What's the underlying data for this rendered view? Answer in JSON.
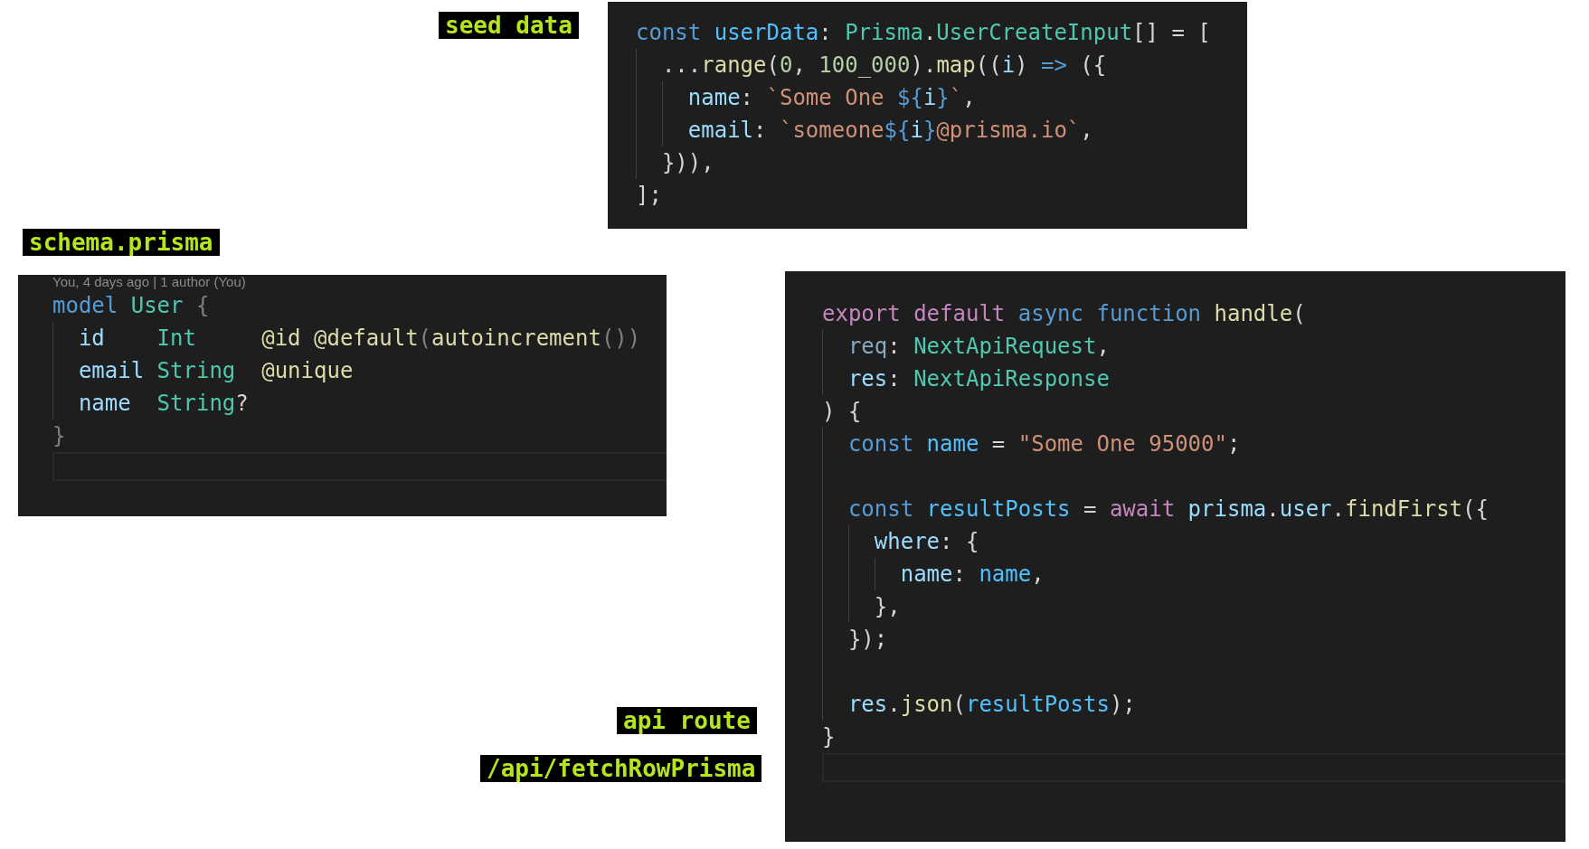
{
  "labels": [
    {
      "text": "seed data"
    },
    {
      "text": "schema.prisma"
    },
    {
      "text": "api route"
    },
    {
      "text": "/api/fetchRowPrisma"
    }
  ],
  "panels": [
    {
      "current_line_box": false,
      "lines": [
        {
          "kind": "code",
          "tokens": [
            {
              "kind": "kw",
              "text": "const "
            },
            {
              "kind": "vblue",
              "text": "userData"
            },
            {
              "kind": "p",
              "text": ": "
            },
            {
              "kind": "type",
              "text": "Prisma"
            },
            {
              "kind": "p",
              "text": "."
            },
            {
              "kind": "type",
              "text": "UserCreateInput"
            },
            {
              "kind": "p",
              "text": "[] = ["
            }
          ]
        },
        {
          "kind": "code",
          "tokens": [
            {
              "kind": "p",
              "text": "  ..."
            },
            {
              "kind": "fn",
              "text": "range"
            },
            {
              "kind": "p",
              "text": "("
            },
            {
              "kind": "num",
              "text": "0"
            },
            {
              "kind": "p",
              "text": ", "
            },
            {
              "kind": "num",
              "text": "100_000"
            },
            {
              "kind": "p",
              "text": ")."
            },
            {
              "kind": "fn",
              "text": "map"
            },
            {
              "kind": "p",
              "text": "(("
            },
            {
              "kind": "var",
              "text": "i"
            },
            {
              "kind": "p",
              "text": ") "
            },
            {
              "kind": "kw",
              "text": "=>"
            },
            {
              "kind": "p",
              "text": " ({"
            }
          ]
        },
        {
          "kind": "code",
          "tokens": [
            {
              "kind": "var",
              "text": "    name"
            },
            {
              "kind": "p",
              "text": ": "
            },
            {
              "kind": "str",
              "text": "`Some One "
            },
            {
              "kind": "kw",
              "text": "${"
            },
            {
              "kind": "var",
              "text": "i"
            },
            {
              "kind": "kw",
              "text": "}"
            },
            {
              "kind": "str",
              "text": "`"
            },
            {
              "kind": "p",
              "text": ","
            }
          ]
        },
        {
          "kind": "code",
          "tokens": [
            {
              "kind": "var",
              "text": "    email"
            },
            {
              "kind": "p",
              "text": ": "
            },
            {
              "kind": "str",
              "text": "`someone"
            },
            {
              "kind": "kw",
              "text": "${"
            },
            {
              "kind": "var",
              "text": "i"
            },
            {
              "kind": "kw",
              "text": "}"
            },
            {
              "kind": "str",
              "text": "@prisma.io`"
            },
            {
              "kind": "p",
              "text": ","
            }
          ]
        },
        {
          "kind": "code",
          "tokens": [
            {
              "kind": "p",
              "text": "  })),"
            }
          ]
        },
        {
          "kind": "code",
          "tokens": [
            {
              "kind": "p",
              "text": "];"
            }
          ]
        }
      ]
    },
    {
      "blame": "You, 4 days ago | 1 author (You)",
      "current_line_box": true,
      "lines": [
        {
          "kind": "code",
          "tokens": [
            {
              "kind": "kw",
              "text": "model "
            },
            {
              "kind": "type",
              "text": "User "
            },
            {
              "kind": "grey",
              "text": "{"
            }
          ]
        },
        {
          "kind": "code",
          "tokens": [
            {
              "kind": "var",
              "text": "  id    "
            },
            {
              "kind": "type",
              "text": "Int     "
            },
            {
              "kind": "fn",
              "text": "@id @default"
            },
            {
              "kind": "grey",
              "text": "("
            },
            {
              "kind": "fn",
              "text": "autoincrement"
            },
            {
              "kind": "grey",
              "text": "())"
            }
          ]
        },
        {
          "kind": "code",
          "tokens": [
            {
              "kind": "var",
              "text": "  email "
            },
            {
              "kind": "type",
              "text": "String  "
            },
            {
              "kind": "fn",
              "text": "@unique"
            }
          ]
        },
        {
          "kind": "code",
          "tokens": [
            {
              "kind": "var",
              "text": "  name  "
            },
            {
              "kind": "type",
              "text": "String"
            },
            {
              "kind": "p",
              "text": "?"
            }
          ]
        },
        {
          "kind": "code",
          "tokens": [
            {
              "kind": "grey",
              "text": "}"
            }
          ]
        }
      ]
    },
    {
      "current_line_box": true,
      "lines": [
        {
          "kind": "code",
          "tokens": [
            {
              "kind": "ctrl",
              "text": "export default "
            },
            {
              "kind": "kw",
              "text": "async function "
            },
            {
              "kind": "fn",
              "text": "handle"
            },
            {
              "kind": "p",
              "text": "("
            }
          ]
        },
        {
          "kind": "code",
          "tokens": [
            {
              "kind": "dim",
              "text": "  req"
            },
            {
              "kind": "p",
              "text": ": "
            },
            {
              "kind": "type",
              "text": "NextApiRequest"
            },
            {
              "kind": "p",
              "text": ","
            }
          ]
        },
        {
          "kind": "code",
          "tokens": [
            {
              "kind": "var",
              "text": "  res"
            },
            {
              "kind": "p",
              "text": ": "
            },
            {
              "kind": "type",
              "text": "NextApiResponse"
            }
          ]
        },
        {
          "kind": "code",
          "tokens": [
            {
              "kind": "p",
              "text": ") {"
            }
          ]
        },
        {
          "kind": "code",
          "tokens": [
            {
              "kind": "kw",
              "text": "  const "
            },
            {
              "kind": "vblue",
              "text": "name"
            },
            {
              "kind": "p",
              "text": " = "
            },
            {
              "kind": "str",
              "text": "\"Some One 95000\""
            },
            {
              "kind": "p",
              "text": ";"
            }
          ]
        },
        {
          "kind": "blank"
        },
        {
          "kind": "code",
          "tokens": [
            {
              "kind": "kw",
              "text": "  const "
            },
            {
              "kind": "vblue",
              "text": "resultPosts"
            },
            {
              "kind": "p",
              "text": " = "
            },
            {
              "kind": "ctrl",
              "text": "await "
            },
            {
              "kind": "var",
              "text": "prisma"
            },
            {
              "kind": "p",
              "text": "."
            },
            {
              "kind": "var",
              "text": "user"
            },
            {
              "kind": "p",
              "text": "."
            },
            {
              "kind": "fn",
              "text": "findFirst"
            },
            {
              "kind": "p",
              "text": "({"
            }
          ]
        },
        {
          "kind": "code",
          "tokens": [
            {
              "kind": "var",
              "text": "    where"
            },
            {
              "kind": "p",
              "text": ": {"
            }
          ]
        },
        {
          "kind": "code",
          "tokens": [
            {
              "kind": "var",
              "text": "      name"
            },
            {
              "kind": "p",
              "text": ": "
            },
            {
              "kind": "vblue",
              "text": "name"
            },
            {
              "kind": "p",
              "text": ","
            }
          ]
        },
        {
          "kind": "code",
          "tokens": [
            {
              "kind": "p",
              "text": "    },"
            }
          ]
        },
        {
          "kind": "code",
          "tokens": [
            {
              "kind": "p",
              "text": "  });"
            }
          ]
        },
        {
          "kind": "blank"
        },
        {
          "kind": "code",
          "tokens": [
            {
              "kind": "var",
              "text": "  res"
            },
            {
              "kind": "p",
              "text": "."
            },
            {
              "kind": "fn",
              "text": "json"
            },
            {
              "kind": "p",
              "text": "("
            },
            {
              "kind": "vblue",
              "text": "resultPosts"
            },
            {
              "kind": "p",
              "text": ");"
            }
          ]
        },
        {
          "kind": "code",
          "tokens": [
            {
              "kind": "p",
              "text": "}"
            }
          ]
        }
      ]
    }
  ]
}
